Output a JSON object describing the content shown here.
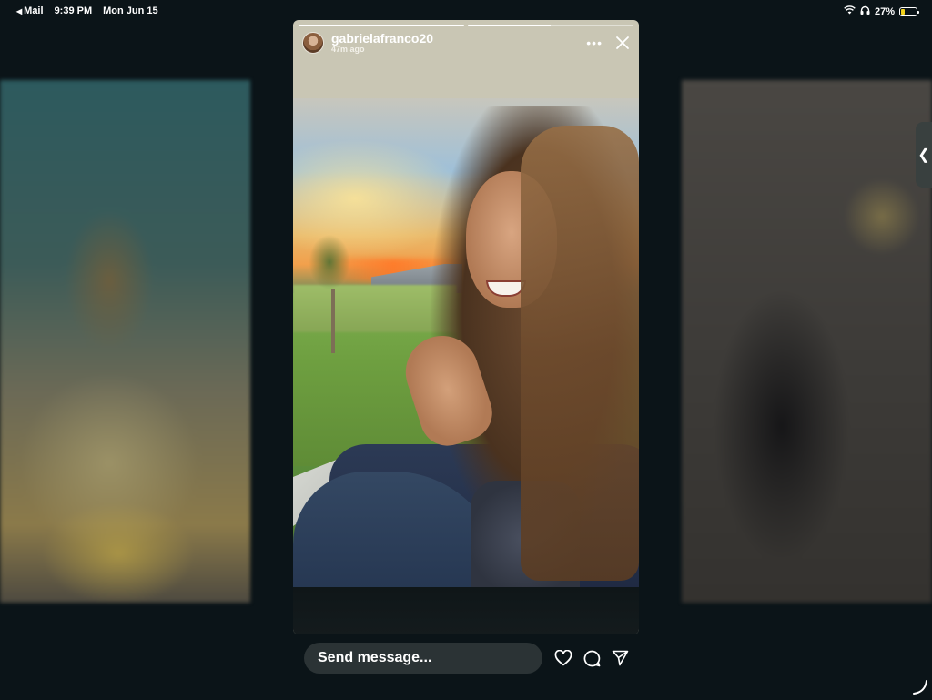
{
  "status_bar": {
    "back_app": "Mail",
    "time": "9:39 PM",
    "date": "Mon Jun 15",
    "battery_percent": "27%",
    "battery_level": 0.27,
    "icons": [
      "wifi-icon",
      "headphones-icon",
      "battery-icon"
    ]
  },
  "story": {
    "username": "gabrielafranco20",
    "timestamp": "47m ago",
    "progress": [
      1.0,
      0.5
    ],
    "icons": [
      "more-icon",
      "close-icon"
    ]
  },
  "reply": {
    "placeholder": "Send message...",
    "icons": [
      "heart-icon",
      "comment-icon",
      "send-icon"
    ]
  },
  "colors": {
    "background": "#0b1418",
    "input_background": "#2b3335",
    "battery_accent": "#f2d21b"
  }
}
